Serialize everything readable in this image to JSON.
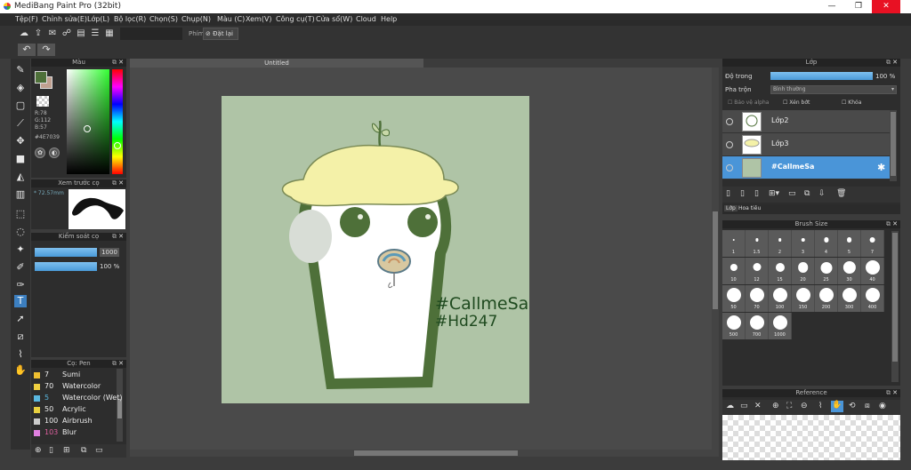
{
  "window": {
    "title": "MediBang Paint Pro (32bit)",
    "min": "—",
    "max": "❐",
    "close": "✕"
  },
  "menu": [
    "Tệp(F)",
    "Chỉnh sửa(E)",
    "Lớp(L)",
    "Bộ lọc(R)",
    "Chọn(S)",
    "Chụp(N)",
    "Màu (C)",
    "Xem(V)",
    "Công cụ(T)",
    "Cửa sổ(W)",
    "Cloud",
    "Help"
  ],
  "toolbar": {
    "shortcut_label": "Phím",
    "reset_label": "Đặt lại"
  },
  "color_panel": {
    "title": "Màu",
    "r": "R:78",
    "g": "G:112",
    "b": "B:57",
    "hex": "#4E7039",
    "fg": "#4e7039"
  },
  "brush_preview": {
    "title": "Xem trước cọ",
    "size": "72.57mm"
  },
  "brush_control": {
    "title": "Kiểm soát cọ",
    "size_value": "1000",
    "opacity_value": "100 %"
  },
  "brush_list": {
    "title": "Cọ: Pen",
    "items": [
      {
        "num": "7",
        "name": "Sumi",
        "color": "#f0c030"
      },
      {
        "num": "70",
        "name": "Watercolor",
        "color": "#f0d040"
      },
      {
        "num": "5",
        "name": "Watercolor (Wet)",
        "color": "#5ab8e0"
      },
      {
        "num": "50",
        "name": "Acrylic",
        "color": "#e8d040"
      },
      {
        "num": "100",
        "name": "Airbrush",
        "color": "#cccccc"
      },
      {
        "num": "103",
        "name": "Blur",
        "color": "#e080e0"
      }
    ]
  },
  "document": {
    "tab": "Untitled",
    "text_line1": "#CallmeSa",
    "text_line2": "#Hd247"
  },
  "layer_panel": {
    "title": "Lớp",
    "opacity_label": "Độ trong",
    "opacity_value": "100 %",
    "blend_label": "Pha trộn",
    "blend_value": "Bình thường",
    "protect_alpha": "Bảo vệ alpha",
    "clipping": "Xén bớt",
    "lock": "Khóa",
    "layers": [
      {
        "name": "Lớp2"
      },
      {
        "name": "Lớp3"
      },
      {
        "name": "#CallmeSa"
      }
    ],
    "tabs": [
      "Lớp",
      "Hoa tiêu"
    ]
  },
  "brush_size": {
    "title": "Brush Size",
    "sizes": [
      "1",
      "1.5",
      "2",
      "3",
      "4",
      "5",
      "7",
      "10",
      "12",
      "15",
      "20",
      "25",
      "30",
      "40",
      "50",
      "70",
      "100",
      "150",
      "200",
      "300",
      "400",
      "500",
      "700",
      "1000"
    ]
  },
  "reference": {
    "title": "Reference"
  }
}
